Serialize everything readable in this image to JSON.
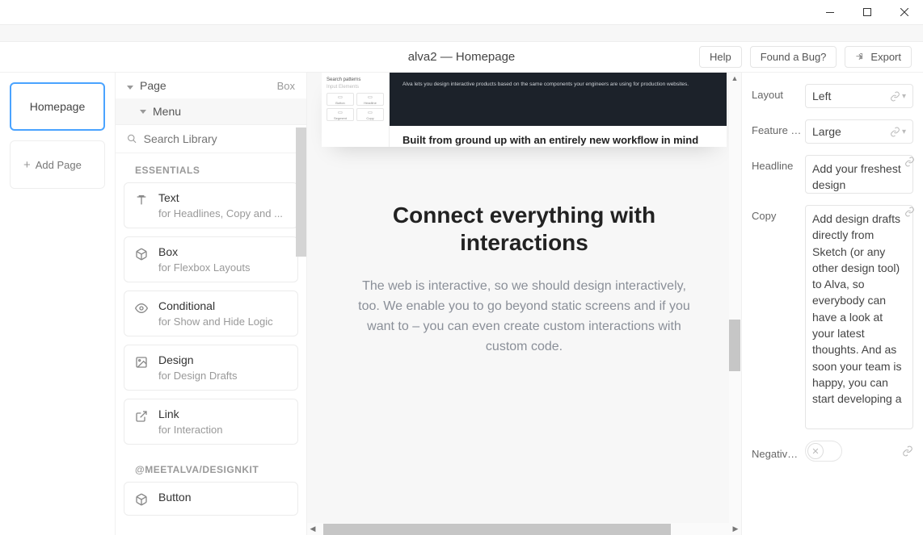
{
  "titlebar": {
    "min": "—",
    "max": "▢",
    "close": "✕"
  },
  "header": {
    "title": "alva2 — Homepage",
    "help": "Help",
    "bug": "Found a Bug?",
    "export": "Export"
  },
  "pages": {
    "current": "Homepage",
    "add_label": "Add Page"
  },
  "outline": {
    "page_label": "Page",
    "box_label": "Box",
    "menu_label": "Menu",
    "search_placeholder": "Search Library",
    "sections": [
      {
        "title": "ESSENTIALS",
        "items": [
          {
            "icon": "text",
            "title": "Text",
            "sub": "for Headlines, Copy and ..."
          },
          {
            "icon": "box",
            "title": "Box",
            "sub": "for Flexbox Layouts"
          },
          {
            "icon": "conditional",
            "title": "Conditional",
            "sub": "for Show and Hide Logic"
          },
          {
            "icon": "design",
            "title": "Design",
            "sub": "for Design Drafts"
          },
          {
            "icon": "link",
            "title": "Link",
            "sub": "for Interaction"
          }
        ]
      },
      {
        "title": "@MEETALVA/DESIGNKIT",
        "items": [
          {
            "icon": "box",
            "title": "Button",
            "sub": ""
          }
        ]
      }
    ]
  },
  "canvas": {
    "thumb_left_title": "Search patterns",
    "thumb_left_sub": "Input Elements",
    "thumb_cells": [
      "Button",
      "Headline",
      "Segment",
      "Copy"
    ],
    "thumb_dark_text": "Alva lets you design interactive products based on the same components your engineers are using for production websites.",
    "thumb_caption": "Built from ground up with an entirely new workflow in mind",
    "heading": "Connect everything with interactions",
    "paragraph": "The web is interactive, so we should design interactively, too. We enable you to go beyond static screens and if you want to – you can even create custom interactions with custom code."
  },
  "props": {
    "layout_label": "Layout",
    "layout_value": "Left",
    "feature_label": "Feature I...",
    "feature_value": "Large",
    "headline_label": "Headline",
    "headline_value": "Add your freshest design",
    "copy_label": "Copy",
    "copy_value": "Add design drafts directly from Sketch (or any other design tool) to Alva, so everybody can have a look at your latest thoughts. And as soon your team is happy, you can start developing a",
    "negative_label": "Negative..."
  }
}
